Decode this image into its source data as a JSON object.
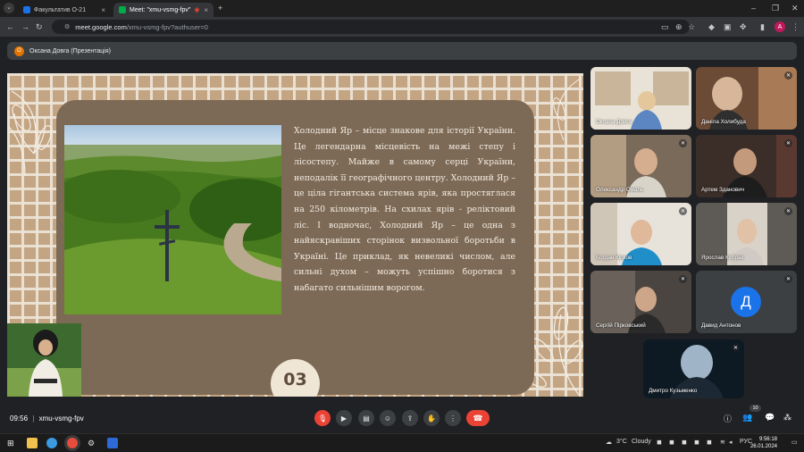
{
  "browser": {
    "tabs": [
      {
        "label": "Факультатив О-21",
        "active": false,
        "favicon_color": "#1a73e8"
      },
      {
        "label": "Meet: \"xmu-vsmg-fpv\"",
        "active": true,
        "favicon_color": "#00ac47"
      }
    ],
    "url_host": "meet.google.com",
    "url_path": "/xmu-vsmg-fpv?authuser=0",
    "profile_initial": "A"
  },
  "presenter_bar": {
    "avatar_initial": "О",
    "label": "Оксана Довга (Презентація)"
  },
  "slide": {
    "text": "Холодний Яр – місце знакове для історії України. Це легендарна місцевість на межі степу і лісостепу. Майже в самому серці України, неподалік її географічного центру. Холодний Яр – це ціла гігантська система ярів, яка простяглася на 250 кілометрів. На схилах ярів - реліктовий ліс. І водночас, Холодний Яр – це одна з найяскравіших сторінок визвольної боротьби в Україні. Це приклад, як невеликі числом, але сильні духом – можуть успішно боротися з набагато сильнішим ворогом.",
    "number": "03"
  },
  "participants": [
    {
      "name": "Оксана Довга",
      "muted": false
    },
    {
      "name": "Даніла Холибуда",
      "muted": true
    },
    {
      "name": "Олександр Смаль",
      "muted": true
    },
    {
      "name": "Артем Зданович",
      "muted": true
    },
    {
      "name": "Богдан Кірков",
      "muted": true
    },
    {
      "name": "Ярослав Кубрак",
      "muted": true
    },
    {
      "name": "Сергій Пірковський",
      "muted": true
    },
    {
      "name": "Давид Антонов",
      "muted": true,
      "avatar_initial": "Д"
    },
    {
      "name": "Дмитро Кузьменко",
      "muted": true
    }
  ],
  "meeting": {
    "time": "09:56",
    "separator": "|",
    "code": "xmu-vsmg-fpv",
    "participant_count": "10"
  },
  "taskbar": {
    "weather_temp": "3°C",
    "weather_text": "Cloudy",
    "language": "РУС",
    "time": "9:56:18",
    "date": "26.01.2024"
  },
  "colors": {
    "accent_red": "#ea4335",
    "meet_bg": "#202124",
    "slide_beige": "#c4a583",
    "slide_card": "#7d6a56"
  }
}
